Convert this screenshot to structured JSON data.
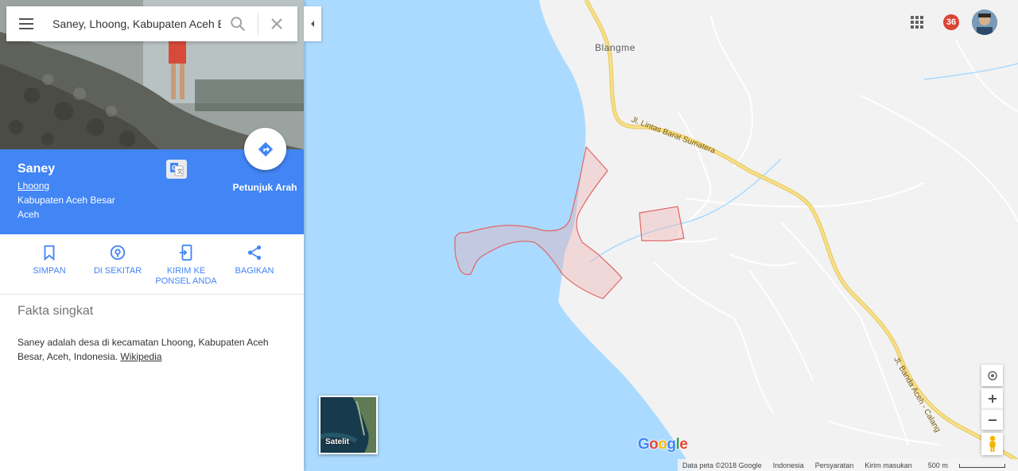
{
  "search": {
    "value": "Saney, Lhoong, Kabupaten Aceh Besar",
    "icons": {
      "menu": "hamburger-menu-icon",
      "search": "search-icon",
      "clear": "close-icon"
    }
  },
  "place": {
    "name": "Saney",
    "line1": "Lhoong",
    "line2": "Kabupaten Aceh Besar",
    "line3": "Aceh",
    "directions_label": "Petunjuk Arah"
  },
  "actions": [
    {
      "label_line1": "SIMPAN",
      "label_line2": "",
      "icon": "bookmark-icon"
    },
    {
      "label_line1": "DI SEKITAR",
      "label_line2": "",
      "icon": "location-pin-icon"
    },
    {
      "label_line1": "KIRIM KE",
      "label_line2": "PONSEL ANDA",
      "icon": "send-to-phone-icon"
    },
    {
      "label_line1": "BAGIKAN",
      "label_line2": "",
      "icon": "share-icon"
    }
  ],
  "facts": {
    "title": "Fakta singkat",
    "text": "Saney adalah desa di kecamatan Lhoong, Kabupaten Aceh Besar, Aceh, Indonesia. ",
    "link": "Wikipedia"
  },
  "topbar": {
    "notification_count": "36"
  },
  "map": {
    "town_label": "Blangme",
    "road_1": "Jl. Lintas Barat Sumatera",
    "road_2": "Jl. Banda Aceh - Calang",
    "satellite_label": "Satelit",
    "logo": "Google",
    "colors": {
      "water": "#aadaff",
      "land": "#f2f2f2",
      "highway": "#f4d96b",
      "boundary": "#e06666"
    }
  },
  "footer": {
    "attribution": "Data peta ©2018 Google",
    "country": "Indonesia",
    "terms": "Persyaratan",
    "feedback": "Kirim masukan",
    "scale": "500 m"
  }
}
